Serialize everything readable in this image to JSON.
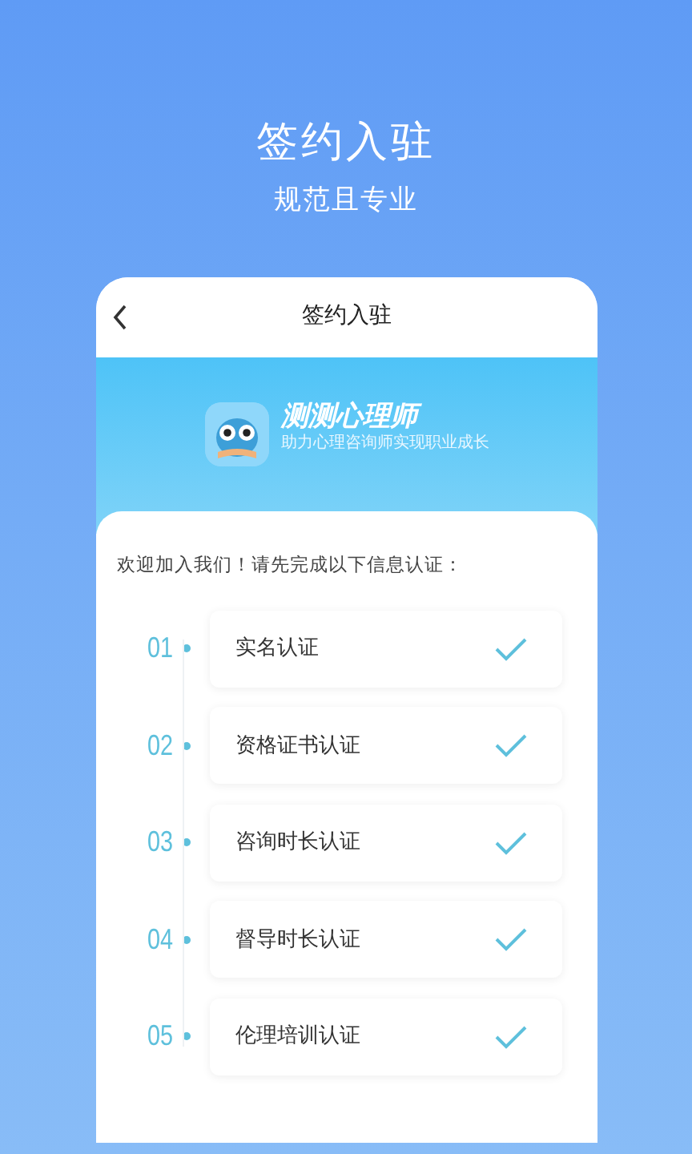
{
  "headline": "签约入驻",
  "subheadline": "规范且专业",
  "screen": {
    "nav_title": "签约入驻",
    "app_name": "测测心理师",
    "app_slogan": "助力心理咨询师实现职业成长",
    "intro": "欢迎加入我们！请先完成以下信息认证：",
    "steps": [
      {
        "number": "01",
        "label": "实名认证",
        "checked": true
      },
      {
        "number": "02",
        "label": "资格证书认证",
        "checked": true
      },
      {
        "number": "03",
        "label": "咨询时长认证",
        "checked": true
      },
      {
        "number": "04",
        "label": "督导时长认证",
        "checked": true
      },
      {
        "number": "05",
        "label": "伦理培训认证",
        "checked": true
      }
    ]
  }
}
